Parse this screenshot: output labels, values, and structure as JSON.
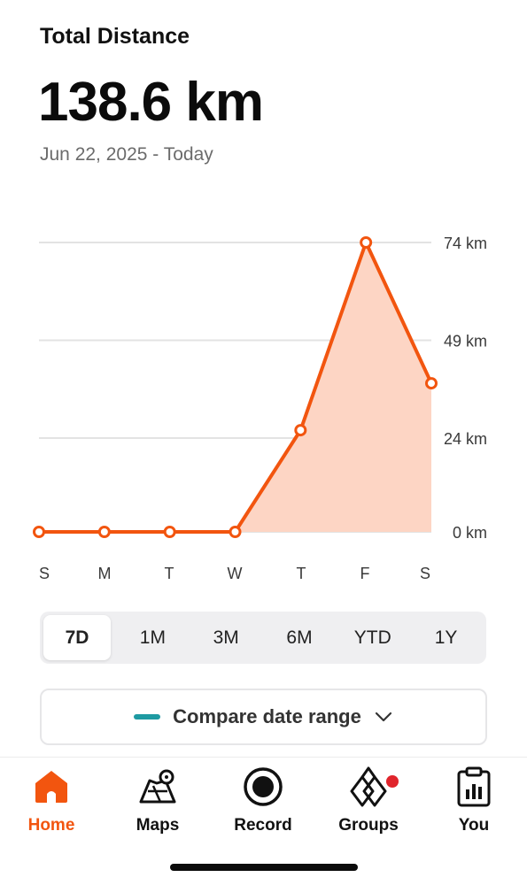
{
  "header": {
    "title": "Total Distance",
    "total": "138.6 km",
    "date_range": "Jun 22, 2025 - Today"
  },
  "colors": {
    "accent": "#f2550f",
    "fill": "#fdd5c4",
    "grid": "#e3e3e3",
    "compare_swatch": "#1e9aa2",
    "badge": "#e0242c"
  },
  "chart_data": {
    "type": "area",
    "categories": [
      "S",
      "M",
      "T",
      "W",
      "T",
      "F",
      "S"
    ],
    "values": [
      0,
      0,
      0,
      0,
      26,
      74,
      38
    ],
    "yticks": [
      0,
      24,
      49,
      74
    ],
    "ytick_labels": [
      "0 km",
      "24 km",
      "49 km",
      "74 km"
    ],
    "ylim": [
      0,
      74
    ],
    "grid": true,
    "axis_side": "right"
  },
  "ranges": [
    {
      "label": "7D",
      "active": true
    },
    {
      "label": "1M",
      "active": false
    },
    {
      "label": "3M",
      "active": false
    },
    {
      "label": "6M",
      "active": false
    },
    {
      "label": "YTD",
      "active": false
    },
    {
      "label": "1Y",
      "active": false
    }
  ],
  "compare": {
    "label": "Compare date range"
  },
  "tabs": [
    {
      "label": "Home",
      "icon": "home-icon",
      "active": true
    },
    {
      "label": "Maps",
      "icon": "map-icon",
      "active": false
    },
    {
      "label": "Record",
      "icon": "record-icon",
      "active": false
    },
    {
      "label": "Groups",
      "icon": "groups-icon",
      "active": false,
      "badge": true
    },
    {
      "label": "You",
      "icon": "clipboard-chart-icon",
      "active": false
    }
  ]
}
